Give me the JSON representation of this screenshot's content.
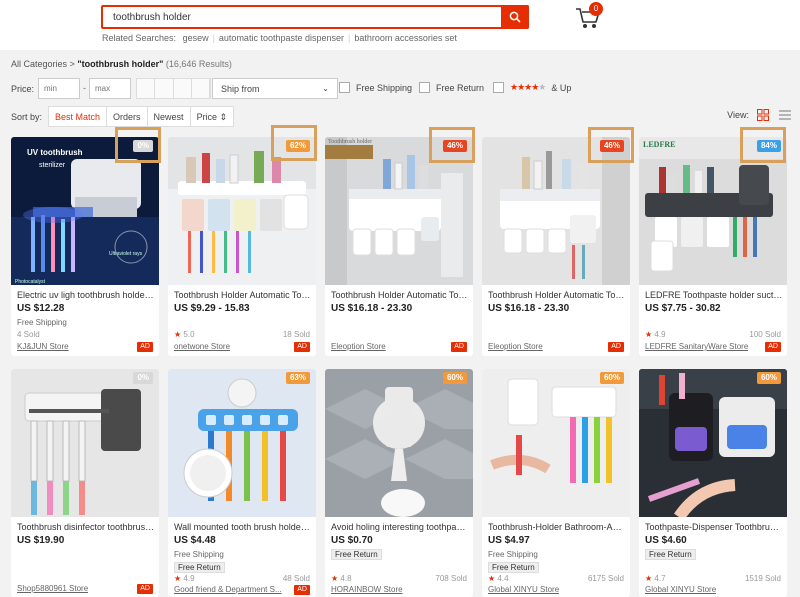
{
  "search": {
    "value": "toothbrush holder",
    "placeholder": ""
  },
  "cart": {
    "count": "0"
  },
  "related": {
    "label": "Related Searches:",
    "items": [
      "gesew",
      "automatic toothpaste dispenser",
      "bathroom accessories set"
    ]
  },
  "breadcrumb": {
    "root": "All Categories",
    "sep": ">",
    "query": "\"toothbrush holder\"",
    "count": "(16,646 Results)"
  },
  "filters": {
    "price_label": "Price:",
    "min_placeholder": "min",
    "max_placeholder": "max",
    "dash": "-",
    "ship_from": "Ship from",
    "free_shipping": "Free Shipping",
    "free_return": "Free Return",
    "stars_filled": "★★★★",
    "stars_empty": "★",
    "and_up": "& Up"
  },
  "sort": {
    "label": "Sort by:",
    "tabs": [
      "Best Match",
      "Orders",
      "Newest",
      "Price"
    ],
    "price_arrows": "⇕",
    "views_label": "View:"
  },
  "colors": {
    "accent": "#e62e04",
    "highlight_box": "#d9a05b"
  },
  "products": [
    {
      "title": "Electric uv ligh toothbrush holder w...",
      "price": "US $12.28",
      "free_ship": "Free Shipping",
      "rating": "",
      "sold": "4 Sold",
      "store": "KJ&JUN Store",
      "ad": "AD",
      "discount": "0%"
    },
    {
      "title": "Toothbrush Holder Automatic Toot...",
      "price": "US $9.29 - 15.83",
      "free_ship": "",
      "rating": "5.0",
      "sold": "18 Sold",
      "store": "onetwone Store",
      "ad": "AD",
      "discount": "62%"
    },
    {
      "title": "Toothbrush Holder Automatic Toot...",
      "price": "US $16.18 - 23.30",
      "free_ship": "",
      "rating": "",
      "sold": "",
      "store": "Eleoption Store",
      "ad": "AD",
      "discount": "46%"
    },
    {
      "title": "Toothbrush Holder Automatic Toot...",
      "price": "US $16.18 - 23.30",
      "free_ship": "",
      "rating": "",
      "sold": "",
      "store": "Eleoption Store",
      "ad": "AD",
      "discount": "46%"
    },
    {
      "title": "LEDFRE Toothpaste holder suction ...",
      "price": "US $7.75 - 30.82",
      "free_ship": "",
      "rating": "4.9",
      "sold": "100 Sold",
      "store": "LEDFRE SanitaryWare Store",
      "ad": "AD",
      "discount": "84%"
    },
    {
      "title": "Toothbrush disinfector toothbrush ...",
      "price": "US $19.90",
      "free_ship": "",
      "rating": "",
      "sold": "",
      "store": "Shop5880961 Store",
      "ad": "AD",
      "discount": "0%"
    },
    {
      "title": "Wall mounted tooth brush holder c...",
      "price": "US $4.48",
      "free_ship": "Free Shipping",
      "free_return": "Free Return",
      "rating": "4.9",
      "sold": "48 Sold",
      "store": "Good friend & Department S...",
      "ad": "AD",
      "discount": "63%"
    },
    {
      "title": "Avoid holing interesting toothpaste...",
      "price": "US $0.70",
      "free_return": "Free Return",
      "rating": "4.8",
      "sold": "708 Sold",
      "store": "HORAINBOW Store",
      "ad": "",
      "discount": "60%"
    },
    {
      "title": "Toothbrush-Holder Bathroom-Acc...",
      "price": "US $4.97",
      "free_ship": "Free Shipping",
      "free_return": "Free Return",
      "rating": "4.4",
      "sold": "6175 Sold",
      "store": "Global XINYU Store",
      "ad": "",
      "discount": "60%"
    },
    {
      "title": "Toothpaste-Dispenser Toothbrush-...",
      "price": "US $4.60",
      "free_return": "Free Return",
      "rating": "4.7",
      "sold": "1519 Sold",
      "store": "Global XINYU Store",
      "ad": "",
      "discount": "60%"
    }
  ],
  "image_text": {
    "p1_line1": "UV toothbrush",
    "p1_line2": "sterilizer",
    "p1_caption1": "Photocatalyst",
    "p1_caption2": "Ultraviolet rays",
    "p3_banner": "Toothbrush holder",
    "p5_brand": "LEDFRE"
  }
}
